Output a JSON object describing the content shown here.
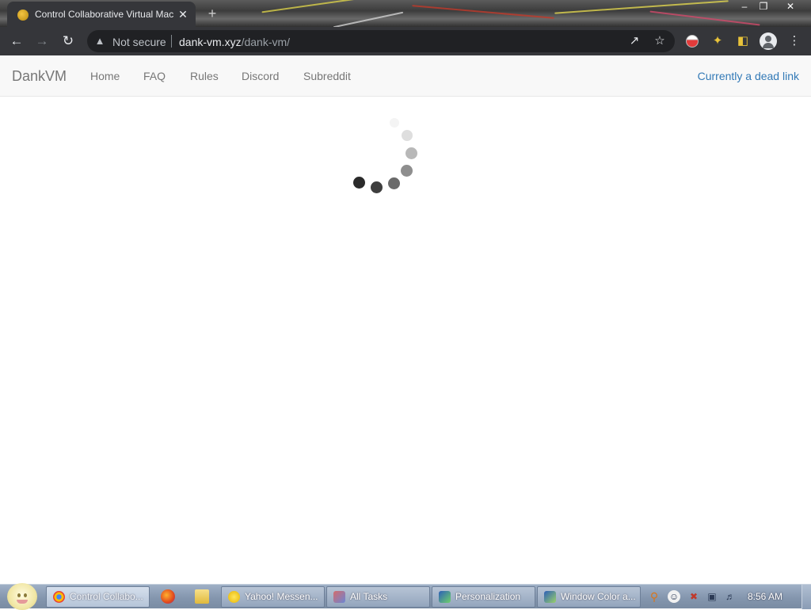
{
  "browser": {
    "tab_title": "Control Collaborative Virtual Machines",
    "tab_close_glyph": "✕",
    "new_tab_glyph": "+",
    "security_label": "Not secure",
    "url_host": "dank-vm.xyz",
    "url_path": "/dank-vm/",
    "icons": [
      "back-icon",
      "forward-icon",
      "reload-icon",
      "warning-icon",
      "share-icon",
      "star-icon",
      "extension-flag-icon",
      "puzzle-extensions-icon",
      "sidebar-icon",
      "profile-icon",
      "menu-kebab-icon"
    ]
  },
  "site": {
    "brand": "DankVM",
    "nav": [
      "Home",
      "FAQ",
      "Rules",
      "Discord",
      "Subreddit"
    ],
    "right_link": "Currently a dead link",
    "accent_color": "#337ab7"
  },
  "spinner": {
    "state": "loading"
  },
  "taskbar": {
    "tasks": [
      {
        "label": "Control Collabo...",
        "icon": "chrome-icon",
        "active": true
      },
      {
        "label": "Yahoo! Messen...",
        "icon": "yahoo-messenger-icon",
        "active": false
      },
      {
        "label": "All Tasks",
        "icon": "control-panel-icon",
        "active": false
      },
      {
        "label": "Personalization",
        "icon": "personalization-icon",
        "active": false
      },
      {
        "label": "Window Color a...",
        "icon": "window-color-icon",
        "active": false
      }
    ],
    "quick_launch": [
      "firefox-icon",
      "folder-icon"
    ],
    "tray_icons": [
      "search-icon",
      "messenger-tray-icon",
      "network-error-icon",
      "network-icon",
      "volume-icon"
    ],
    "clock": "8:56 AM"
  }
}
